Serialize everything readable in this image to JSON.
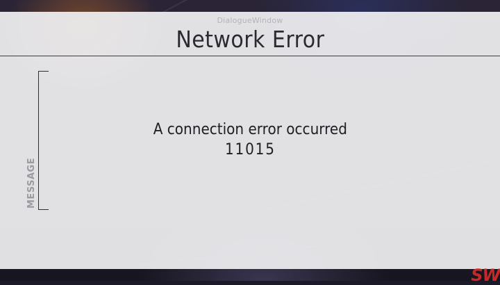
{
  "dialog": {
    "window_label": "DialogueWindow",
    "title": "Network Error",
    "side_label": "MESSAGE",
    "message": "A connection error occurred",
    "error_code": "11015"
  },
  "logo": {
    "text": "SW",
    "color": "#c62828"
  }
}
